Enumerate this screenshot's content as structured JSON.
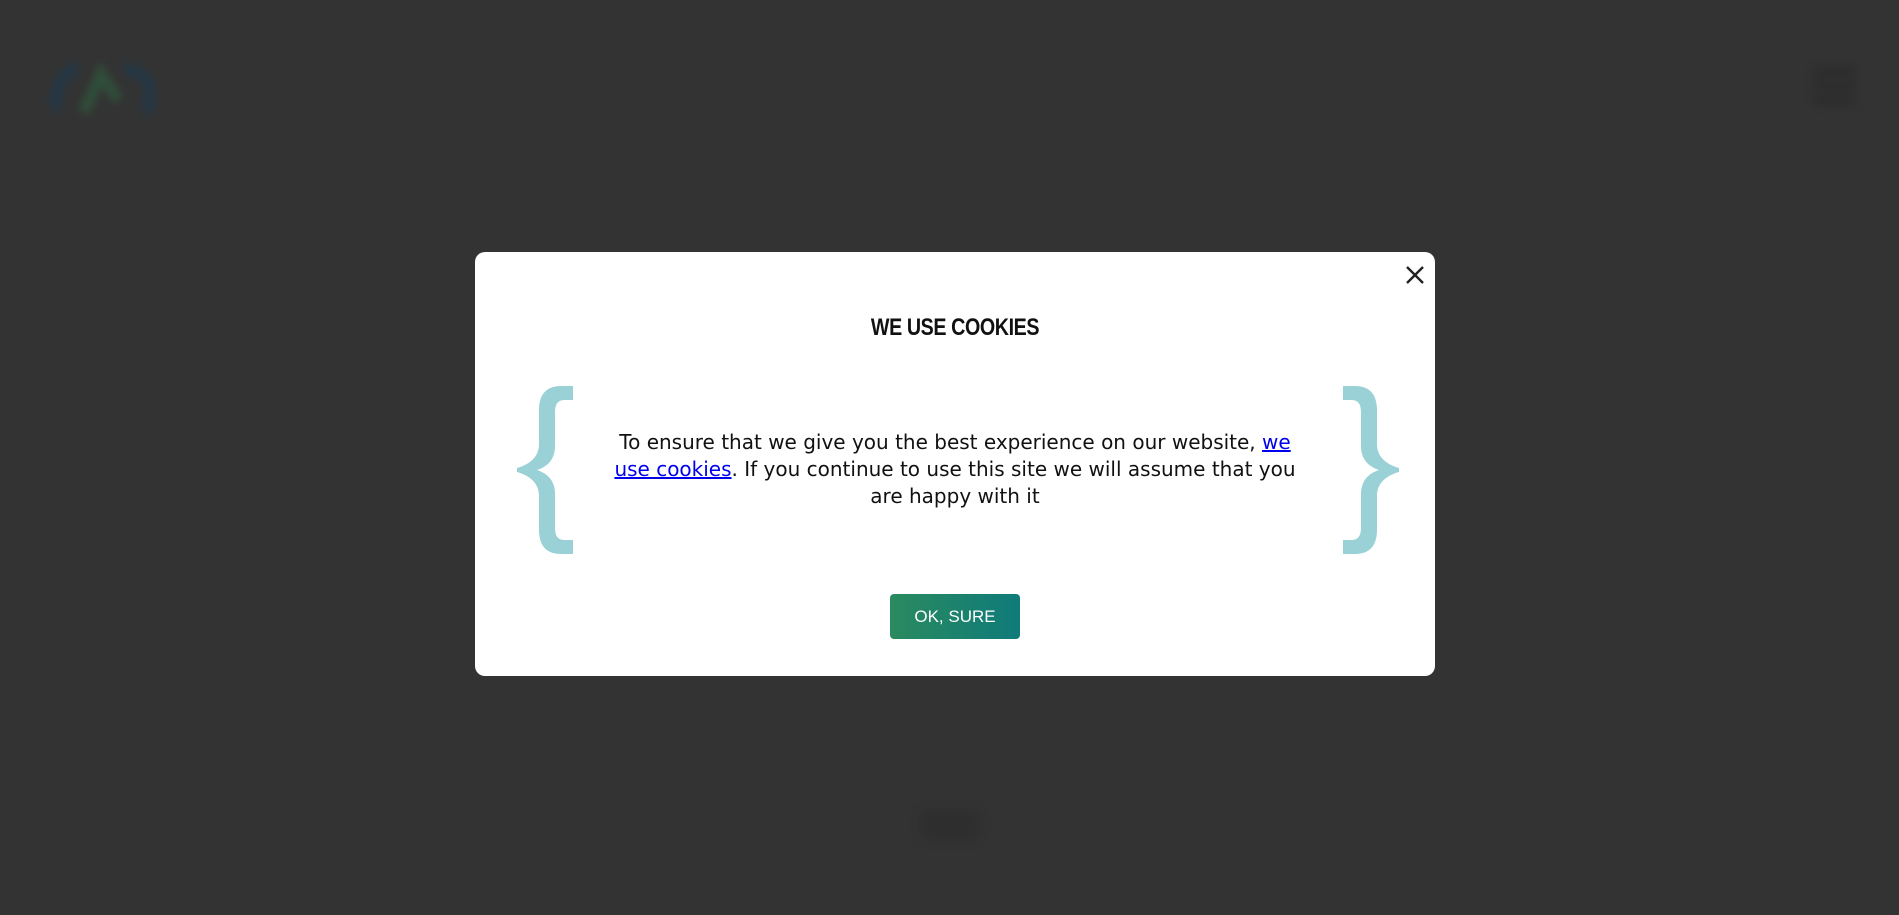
{
  "cookie_modal": {
    "title": "WE USE COOKIES",
    "text_before": "To ensure that we give you the best experience on our website, ",
    "link_text": "we use cookies",
    "text_after": ". If you continue to use this site we will assume that you are happy with it",
    "ok_button": "OK, SURE",
    "brace_color": "#9ad1d6",
    "close_icon": "close-icon"
  },
  "background": {
    "overlay_color": "#333333",
    "logo_icon": "site-logo",
    "menu_icon": "hamburger-icon"
  }
}
